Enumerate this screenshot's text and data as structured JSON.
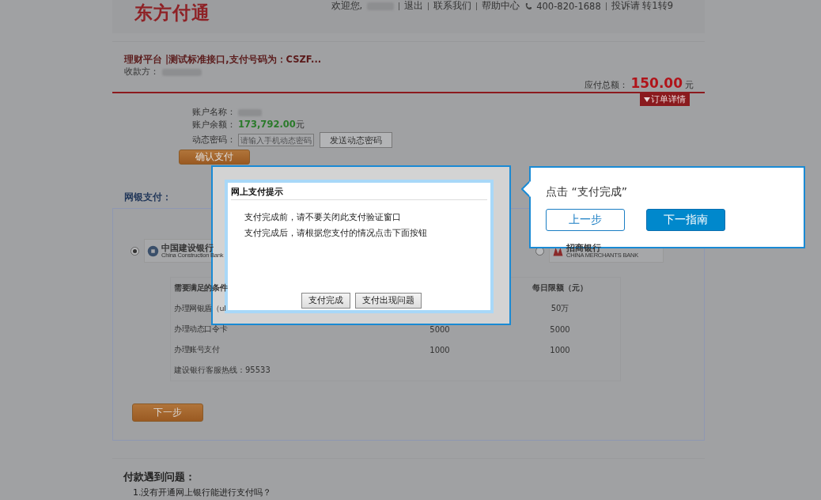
{
  "header": {
    "logo": "东方付通",
    "links": [
      {
        "kind": "text",
        "text": "欢迎您,"
      },
      {
        "kind": "blurred"
      },
      {
        "kind": "link",
        "text": "退出"
      },
      {
        "kind": "link",
        "text": "联系我们"
      },
      {
        "kind": "link",
        "text": "帮助中心"
      },
      {
        "kind": "phone",
        "text": "400-820-1688"
      },
      {
        "kind": "link",
        "text": "投诉请 转1转9"
      }
    ]
  },
  "order": {
    "title": "理财平台 |测试标准接口,支付号码为：CSZF...",
    "payee_label": "收款方：",
    "total_label": "应付总额：",
    "total": "150.00",
    "currency": "元",
    "details_button": "订单详情"
  },
  "account": {
    "name_label": "账户名称：",
    "balance_label": "账户余额：",
    "balance": "173,792.00",
    "balance_unit": "元",
    "otp_label": "动态密码：",
    "otp_placeholder": "请输入手机动态密码",
    "send_button": "发送动态密码",
    "confirm_button": "确认支付"
  },
  "netbank": {
    "label": "网银支付：",
    "banks": [
      {
        "name": "中国建设银行",
        "sub": "China Construction Bank",
        "selected": true
      },
      {
        "name": "招商银行",
        "sub": "CHINA MERCHANTS BANK",
        "selected": false
      }
    ],
    "table": {
      "columns": [
        "需要满足的条件",
        "每日限额（元）"
      ],
      "rows": [
        {
          "condition": "办理网银盾（ul",
          "daily": "50万"
        },
        {
          "condition": "办理动态口令卡",
          "limit": "5000",
          "daily": "5000"
        },
        {
          "condition": "办理账号支付",
          "limit": "1000",
          "daily": "1000"
        }
      ]
    },
    "hotline": "建设银行客服热线：95533",
    "next_button": "下一步"
  },
  "faq": {
    "title": "付款遇到问题：",
    "items": [
      "1.没有开通网上银行能进行支付吗？"
    ]
  },
  "dialog": {
    "title": "网上支付提示",
    "lines": [
      "支付完成前，请不要关闭此支付验证窗口",
      "支付完成后，请根据您支付的情况点击下面按钮"
    ],
    "buttons": [
      "支付完成",
      "支付出现问题"
    ]
  },
  "guide": {
    "text": "点击 “支付完成”",
    "buttons": [
      {
        "label": "上一步",
        "kind": "secondary"
      },
      {
        "label": "下一指南",
        "kind": "primary"
      }
    ]
  }
}
